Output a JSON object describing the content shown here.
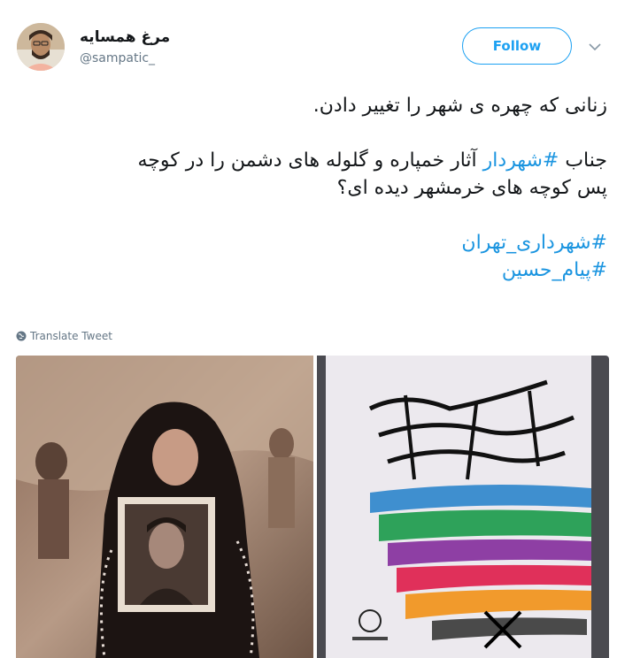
{
  "user": {
    "name": "مرغ همسایه",
    "handle": "@sampatic_"
  },
  "follow_label": "Follow",
  "tweet": {
    "line1": "زنانی که چهره ی شهر را تغییر دادن.",
    "line2_prefix": "جناب ",
    "line2_hashtag": "#شهردار",
    "line2_rest": " آثار خمپاره و گلوله های دشمن را در کوچه",
    "line3": "پس کوچه های خرمشهر دیده ای؟",
    "hashtag1": "#شهرداری_تهران",
    "hashtag2": "#پیام_حسین"
  },
  "translate_label": "Translate Tweet",
  "colors": {
    "accent": "#1da1f2",
    "hashtag": "#1b95e0",
    "muted": "#657786"
  },
  "icons": {
    "chevron": "chevron-down-icon",
    "globe": "globe-icon"
  }
}
